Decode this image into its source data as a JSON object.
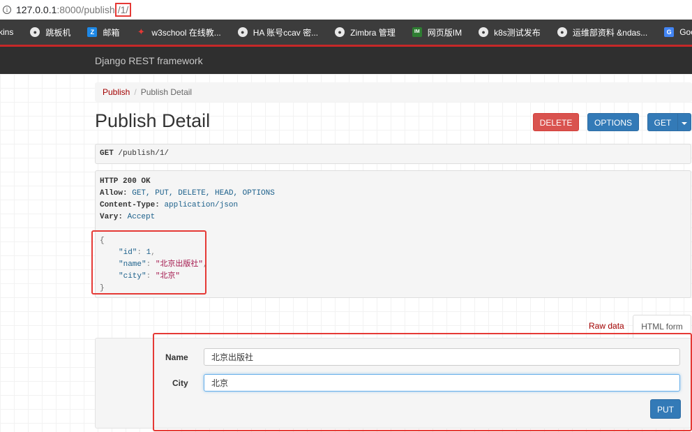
{
  "browser": {
    "url_host": "127.0.0.1",
    "url_port": ":8000/publish",
    "url_highlight": "/1/",
    "bookmarks": [
      {
        "label": "kins",
        "icon": "none"
      },
      {
        "label": "跳板机",
        "icon": "globe-icon"
      },
      {
        "label": "邮箱",
        "icon": "zimbra-z-icon"
      },
      {
        "label": "w3school 在线教...",
        "icon": "w3school-icon"
      },
      {
        "label": "HA  账号ccav  密...",
        "icon": "globe-icon"
      },
      {
        "label": "Zimbra 管理",
        "icon": "globe-icon"
      },
      {
        "label": "网页版IM",
        "icon": "im-icon"
      },
      {
        "label": "k8s测试发布",
        "icon": "globe-icon"
      },
      {
        "label": "运维部资料 &ndas...",
        "icon": "globe-icon"
      },
      {
        "label": "Goo",
        "icon": "google-icon"
      }
    ]
  },
  "navbar": {
    "brand": "Django REST framework"
  },
  "breadcrumb": {
    "parent": "Publish",
    "separator": "/",
    "current": "Publish Detail"
  },
  "page": {
    "title": "Publish Detail"
  },
  "actions": {
    "delete": "DELETE",
    "options": "OPTIONS",
    "get": "GET"
  },
  "request": {
    "method": "GET",
    "path": "/publish/1/"
  },
  "response": {
    "status": "HTTP 200 OK",
    "headers": [
      {
        "name": "Allow:",
        "value": "GET, PUT, DELETE, HEAD, OPTIONS"
      },
      {
        "name": "Content-Type:",
        "value": "application/json"
      },
      {
        "name": "Vary:",
        "value": "Accept"
      }
    ],
    "json": {
      "open": "{",
      "close": "}",
      "fields": [
        {
          "key": "\"id\"",
          "value": "1",
          "type": "num",
          "trail": ","
        },
        {
          "key": "\"name\"",
          "value": "\"北京出版社\"",
          "type": "str",
          "trail": ","
        },
        {
          "key": "\"city\"",
          "value": "\"北京\"",
          "type": "str",
          "trail": ""
        }
      ]
    }
  },
  "form": {
    "tab_raw": "Raw data",
    "tab_html": "HTML form",
    "name_label": "Name",
    "name_value": "北京出版社",
    "city_label": "City",
    "city_value": "北京",
    "submit": "PUT"
  },
  "colors": {
    "accent": "#337ab7",
    "danger": "#d9534f",
    "link": "#a30000",
    "highlight": "#e53935"
  }
}
